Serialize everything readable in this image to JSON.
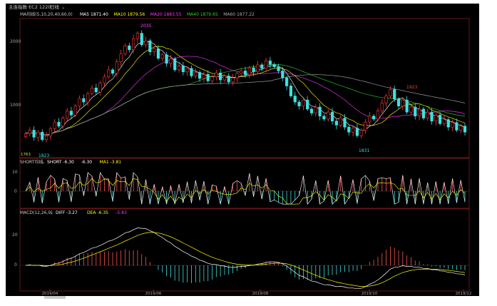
{
  "window": {
    "title": "主连指数·EC2 1220",
    "period_label": "日线"
  },
  "panels": {
    "main": {
      "ma_label": "MA均线(5,10,20,40,60,0)",
      "legend": [
        {
          "text": "MA5 1871.40",
          "color": "#ffffff"
        },
        {
          "text": "MA10 1879.56",
          "color": "#ffff00"
        },
        {
          "text": "MA20 1883.55",
          "color": "#ff33ff"
        },
        {
          "text": "MA40 1879.65",
          "color": "#33cc33"
        },
        {
          "text": "MA60 1877.22",
          "color": "#aaaaaa"
        }
      ],
      "y_ticks": [
        "2000",
        "1000"
      ],
      "annotations": [
        "1823",
        "2035",
        "1831",
        "1923"
      ],
      "last_price_label": "1763"
    },
    "short": {
      "label": "SHORT均线",
      "legend": [
        {
          "text": "SHORT -6.30",
          "color": "#ffffff"
        },
        {
          "text": "-6.30",
          "color": "#ffffff"
        },
        {
          "text": "MA1 -3.81",
          "color": "#ffff00"
        }
      ],
      "y_ticks": [
        "10",
        "0"
      ]
    },
    "macd": {
      "label": "MACD(12,26,9)",
      "legend": [
        {
          "text": "DIFF -3.27",
          "color": "#ffffff"
        },
        {
          "text": "DEA -6.35",
          "color": "#ffff00"
        },
        {
          "text": "-5.83",
          "color": "#ff33ff"
        }
      ],
      "y_ticks": [
        "20",
        "0"
      ]
    }
  },
  "x_labels": [
    "2019/04",
    "2019/06",
    "2019/08",
    "2019/10",
    "2019/12"
  ],
  "chart_data": {
    "type": "candlestick",
    "price_range": [
      1760,
      2060
    ],
    "price_ticks": [
      2000,
      1000
    ],
    "closes": [
      1835,
      1842,
      1828,
      1838,
      1823,
      1830,
      1845,
      1858,
      1850,
      1866,
      1880,
      1872,
      1890,
      1905,
      1898,
      1915,
      1926,
      1918,
      1936,
      1948,
      1962,
      1955,
      1978,
      1994,
      2010,
      2002,
      2024,
      2035,
      2012,
      2020,
      1998,
      2004,
      1985,
      1992,
      1975,
      1984,
      1962,
      1970,
      1958,
      1965,
      1950,
      1957,
      1945,
      1953,
      1940,
      1948,
      1956,
      1942,
      1950,
      1938,
      1946,
      1955,
      1960,
      1952,
      1966,
      1958,
      1972,
      1965,
      1980,
      1973,
      1968,
      1960,
      1946,
      1930,
      1910,
      1898,
      1890,
      1902,
      1884,
      1876,
      1888,
      1870,
      1864,
      1878,
      1860,
      1852,
      1866,
      1848,
      1838,
      1846,
      1831,
      1842,
      1858,
      1870,
      1864,
      1880,
      1896,
      1910,
      1923,
      1904,
      1890,
      1902,
      1878,
      1888,
      1870,
      1884,
      1866,
      1878,
      1860,
      1872,
      1855,
      1863,
      1848,
      1857,
      1842,
      1850,
      1838
    ]
  }
}
